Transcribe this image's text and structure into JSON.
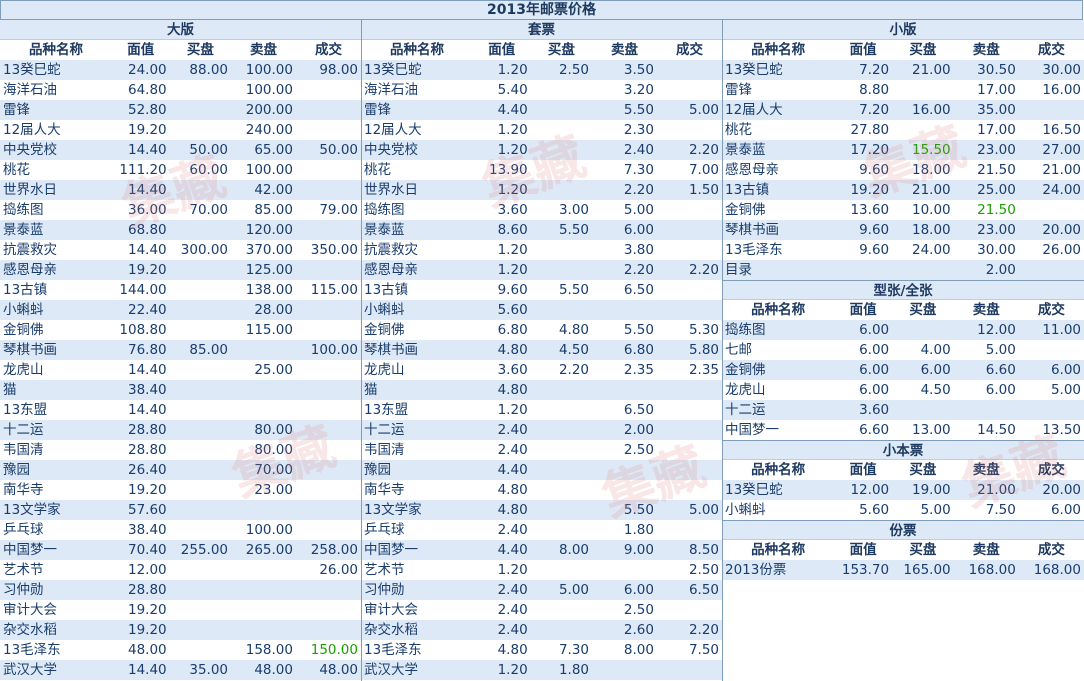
{
  "title": "2013年邮票价格",
  "headers": [
    "品种名称",
    "面值",
    "买盘",
    "卖盘",
    "成交"
  ],
  "watermark": "集藏",
  "sections": {
    "big": {
      "title": "大版",
      "rows": [
        [
          "13癸巳蛇",
          "24.00",
          "88.00",
          "100.00",
          "98.00"
        ],
        [
          "海洋石油",
          "64.80",
          "",
          "100.00",
          ""
        ],
        [
          "雷锋",
          "52.80",
          "",
          "200.00",
          ""
        ],
        [
          "12届人大",
          "19.20",
          "",
          "240.00",
          ""
        ],
        [
          "中央党校",
          "14.40",
          "50.00",
          "65.00",
          "50.00"
        ],
        [
          "桃花",
          "111.20",
          "60.00",
          "100.00",
          ""
        ],
        [
          "世界水日",
          "14.40",
          "",
          "42.00",
          ""
        ],
        [
          "捣练图",
          "36.00",
          "70.00",
          "85.00",
          "79.00"
        ],
        [
          "景泰蓝",
          "68.80",
          "",
          "120.00",
          ""
        ],
        [
          "抗震救灾",
          "14.40",
          "300.00",
          "370.00",
          "350.00"
        ],
        [
          "感恩母亲",
          "19.20",
          "",
          "125.00",
          ""
        ],
        [
          "13古镇",
          "144.00",
          "",
          "138.00",
          "115.00"
        ],
        [
          "小蝌蚪",
          "22.40",
          "",
          "28.00",
          ""
        ],
        [
          "金铜佛",
          "108.80",
          "",
          "115.00",
          ""
        ],
        [
          "琴棋书画",
          "76.80",
          "85.00",
          "",
          "100.00"
        ],
        [
          "龙虎山",
          "14.40",
          "",
          "25.00",
          ""
        ],
        [
          "猫",
          "38.40",
          "",
          "",
          ""
        ],
        [
          "13东盟",
          "14.40",
          "",
          "",
          ""
        ],
        [
          "十二运",
          "28.80",
          "",
          "80.00",
          ""
        ],
        [
          "韦国清",
          "28.80",
          "",
          "80.00",
          ""
        ],
        [
          "豫园",
          "26.40",
          "",
          "70.00",
          ""
        ],
        [
          "南华寺",
          "19.20",
          "",
          "23.00",
          ""
        ],
        [
          "13文学家",
          "57.60",
          "",
          "",
          ""
        ],
        [
          "乒乓球",
          "38.40",
          "",
          "100.00",
          ""
        ],
        [
          "中国梦一",
          "70.40",
          "255.00",
          "265.00",
          "258.00"
        ],
        [
          "艺术节",
          "12.00",
          "",
          "",
          "26.00"
        ],
        [
          "习仲勋",
          "28.80",
          "",
          "",
          ""
        ],
        [
          "审计大会",
          "19.20",
          "",
          "",
          ""
        ],
        [
          "杂交水稻",
          "19.20",
          "",
          "",
          ""
        ],
        [
          "13毛泽东",
          "48.00",
          "",
          "158.00",
          "150.00"
        ],
        [
          "武汉大学",
          "14.40",
          "35.00",
          "48.00",
          "48.00"
        ]
      ]
    },
    "set": {
      "title": "套票",
      "rows": [
        [
          "13癸巳蛇",
          "1.20",
          "2.50",
          "3.50",
          ""
        ],
        [
          "海洋石油",
          "5.40",
          "",
          "3.20",
          ""
        ],
        [
          "雷锋",
          "4.40",
          "",
          "5.50",
          "5.00"
        ],
        [
          "12届人大",
          "1.20",
          "",
          "2.30",
          ""
        ],
        [
          "中央党校",
          "1.20",
          "",
          "2.40",
          "2.20"
        ],
        [
          "桃花",
          "13.90",
          "",
          "7.30",
          "7.00"
        ],
        [
          "世界水日",
          "1.20",
          "",
          "2.20",
          "1.50"
        ],
        [
          "捣练图",
          "3.60",
          "3.00",
          "5.00",
          ""
        ],
        [
          "景泰蓝",
          "8.60",
          "5.50",
          "6.00",
          ""
        ],
        [
          "抗震救灾",
          "1.20",
          "",
          "3.80",
          ""
        ],
        [
          "感恩母亲",
          "1.20",
          "",
          "2.20",
          "2.20"
        ],
        [
          "13古镇",
          "9.60",
          "5.50",
          "6.50",
          ""
        ],
        [
          "小蝌蚪",
          "5.60",
          "",
          "",
          ""
        ],
        [
          "金铜佛",
          "6.80",
          "4.80",
          "5.50",
          "5.30"
        ],
        [
          "琴棋书画",
          "4.80",
          "4.50",
          "6.80",
          "5.80"
        ],
        [
          "龙虎山",
          "3.60",
          "2.20",
          "2.35",
          "2.35"
        ],
        [
          "猫",
          "4.80",
          "",
          "",
          ""
        ],
        [
          "13东盟",
          "1.20",
          "",
          "6.50",
          ""
        ],
        [
          "十二运",
          "2.40",
          "",
          "2.00",
          ""
        ],
        [
          "韦国清",
          "2.40",
          "",
          "2.50",
          ""
        ],
        [
          "豫园",
          "4.40",
          "",
          "",
          ""
        ],
        [
          "南华寺",
          "4.80",
          "",
          "",
          ""
        ],
        [
          "13文学家",
          "4.80",
          "",
          "5.50",
          "5.00"
        ],
        [
          "乒乓球",
          "2.40",
          "",
          "1.80",
          ""
        ],
        [
          "中国梦一",
          "4.40",
          "8.00",
          "9.00",
          "8.50"
        ],
        [
          "艺术节",
          "1.20",
          "",
          "",
          "2.50"
        ],
        [
          "习仲勋",
          "2.40",
          "5.00",
          "6.00",
          "6.50"
        ],
        [
          "审计大会",
          "2.40",
          "",
          "2.50",
          ""
        ],
        [
          "杂交水稻",
          "2.40",
          "",
          "2.60",
          "2.20"
        ],
        [
          "13毛泽东",
          "4.80",
          "7.30",
          "8.00",
          "7.50"
        ],
        [
          "武汉大学",
          "1.20",
          "1.80",
          "",
          ""
        ]
      ]
    },
    "small": {
      "title": "小版",
      "rows": [
        [
          "13癸巳蛇",
          "7.20",
          "21.00",
          "30.50",
          "30.00"
        ],
        [
          "雷锋",
          "8.80",
          "",
          "17.00",
          "16.00"
        ],
        [
          "12届人大",
          "7.20",
          "16.00",
          "35.00",
          ""
        ],
        [
          "桃花",
          "27.80",
          "",
          "17.00",
          "16.50"
        ],
        [
          "景泰蓝",
          "17.20",
          "15.50",
          "23.00",
          "27.00"
        ],
        [
          "感恩母亲",
          "9.60",
          "18.00",
          "21.50",
          "21.00"
        ],
        [
          "13古镇",
          "19.20",
          "21.00",
          "25.00",
          "24.00"
        ],
        [
          "金铜佛",
          "13.60",
          "10.00",
          "21.50",
          ""
        ],
        [
          "琴棋书画",
          "9.60",
          "18.00",
          "23.00",
          "20.00"
        ],
        [
          "13毛泽东",
          "9.60",
          "24.00",
          "30.00",
          "26.00"
        ],
        [
          "目录",
          "",
          "",
          "2.00",
          ""
        ]
      ]
    },
    "sheetlet": {
      "title": "型张/全张",
      "rows": [
        [
          "捣练图",
          "6.00",
          "",
          "12.00",
          "11.00"
        ],
        [
          "七邮",
          "6.00",
          "4.00",
          "5.00",
          ""
        ],
        [
          "金铜佛",
          "6.00",
          "6.00",
          "6.60",
          "6.00"
        ],
        [
          "龙虎山",
          "6.00",
          "4.50",
          "6.00",
          "5.00"
        ],
        [
          "十二运",
          "3.60",
          "",
          "",
          ""
        ],
        [
          "中国梦一",
          "6.60",
          "13.00",
          "14.50",
          "13.50"
        ]
      ]
    },
    "booklet": {
      "title": "小本票",
      "rows": [
        [
          "13癸巳蛇",
          "12.00",
          "19.00",
          "21.00",
          "20.00"
        ],
        [
          "小蝌蚪",
          "5.60",
          "5.00",
          "7.50",
          "6.00"
        ]
      ]
    },
    "yearset": {
      "title": "份票",
      "rows": [
        [
          "2013份票",
          "153.70",
          "165.00",
          "168.00",
          "168.00"
        ]
      ]
    }
  },
  "green_cells": [
    "big.29.4",
    "small.4.2",
    "small.7.3"
  ]
}
